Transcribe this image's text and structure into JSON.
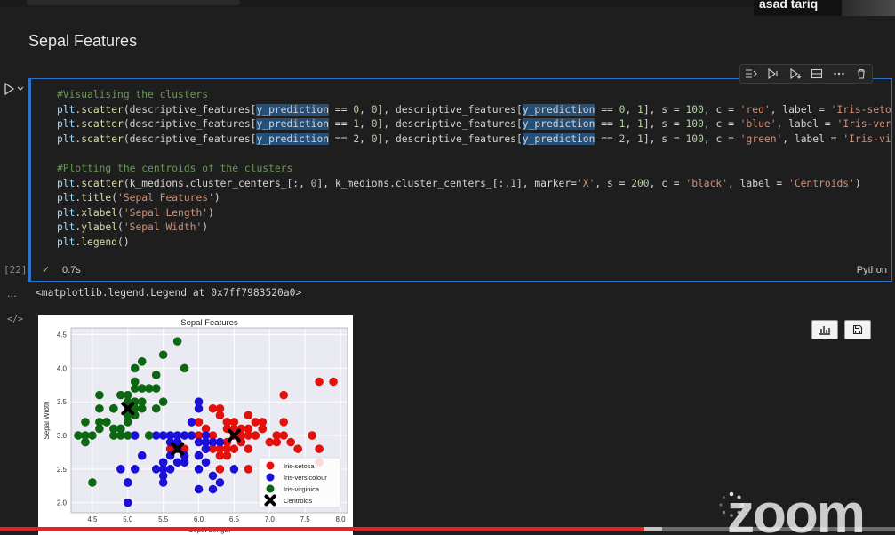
{
  "meeting": {
    "participant_name": "asad tariq",
    "app_logo": "zoom"
  },
  "notebook": {
    "markdown_heading": "Sepal Features",
    "cell": {
      "execution_count": "[22]",
      "exec_time": "0.7s",
      "language": "Python",
      "toolbar_icons": [
        "run-by-line-icon",
        "execute-above-icon",
        "execute-below-icon",
        "split-cell-icon",
        "more-icon",
        "delete-icon"
      ],
      "code_lines": [
        [
          {
            "t": "#Visualising the clusters",
            "c": "comment"
          }
        ],
        [
          {
            "t": "plt",
            "c": "var"
          },
          {
            "t": ".",
            "c": "plain"
          },
          {
            "t": "scatter",
            "c": "fn"
          },
          {
            "t": "(descriptive_features[",
            "c": "plain"
          },
          {
            "t": "y_prediction",
            "c": "hl"
          },
          {
            "t": " == ",
            "c": "plain"
          },
          {
            "t": "0",
            "c": "num"
          },
          {
            "t": ", ",
            "c": "plain"
          },
          {
            "t": "0",
            "c": "num"
          },
          {
            "t": "], descriptive_features[",
            "c": "plain"
          },
          {
            "t": "y_prediction",
            "c": "hl"
          },
          {
            "t": " == ",
            "c": "plain"
          },
          {
            "t": "0",
            "c": "num"
          },
          {
            "t": ", ",
            "c": "plain"
          },
          {
            "t": "1",
            "c": "num"
          },
          {
            "t": "], s = ",
            "c": "plain"
          },
          {
            "t": "100",
            "c": "num"
          },
          {
            "t": ", c = ",
            "c": "plain"
          },
          {
            "t": "'red'",
            "c": "str"
          },
          {
            "t": ", label = ",
            "c": "plain"
          },
          {
            "t": "'Iris-setosa'",
            "c": "str"
          }
        ],
        [
          {
            "t": "plt",
            "c": "var"
          },
          {
            "t": ".",
            "c": "plain"
          },
          {
            "t": "scatter",
            "c": "fn"
          },
          {
            "t": "(descriptive_features[",
            "c": "plain"
          },
          {
            "t": "y_prediction",
            "c": "hl"
          },
          {
            "t": " == ",
            "c": "plain"
          },
          {
            "t": "1",
            "c": "num"
          },
          {
            "t": ", ",
            "c": "plain"
          },
          {
            "t": "0",
            "c": "num"
          },
          {
            "t": "], descriptive_features[",
            "c": "plain"
          },
          {
            "t": "y_prediction",
            "c": "hl"
          },
          {
            "t": " == ",
            "c": "plain"
          },
          {
            "t": "1",
            "c": "num"
          },
          {
            "t": ", ",
            "c": "plain"
          },
          {
            "t": "1",
            "c": "num"
          },
          {
            "t": "], s = ",
            "c": "plain"
          },
          {
            "t": "100",
            "c": "num"
          },
          {
            "t": ", c = ",
            "c": "plain"
          },
          {
            "t": "'blue'",
            "c": "str"
          },
          {
            "t": ", label = ",
            "c": "plain"
          },
          {
            "t": "'Iris-versic",
            "c": "str"
          }
        ],
        [
          {
            "t": "plt",
            "c": "var"
          },
          {
            "t": ".",
            "c": "plain"
          },
          {
            "t": "scatter",
            "c": "fn"
          },
          {
            "t": "(descriptive_features[",
            "c": "plain"
          },
          {
            "t": "y_prediction",
            "c": "hl"
          },
          {
            "t": " == ",
            "c": "plain"
          },
          {
            "t": "2",
            "c": "num"
          },
          {
            "t": ", ",
            "c": "plain"
          },
          {
            "t": "0",
            "c": "num"
          },
          {
            "t": "], descriptive_features[",
            "c": "plain"
          },
          {
            "t": "y_prediction",
            "c": "hl"
          },
          {
            "t": " == ",
            "c": "plain"
          },
          {
            "t": "2",
            "c": "num"
          },
          {
            "t": ", ",
            "c": "plain"
          },
          {
            "t": "1",
            "c": "num"
          },
          {
            "t": "], s = ",
            "c": "plain"
          },
          {
            "t": "100",
            "c": "num"
          },
          {
            "t": ", c = ",
            "c": "plain"
          },
          {
            "t": "'green'",
            "c": "str"
          },
          {
            "t": ", label = ",
            "c": "plain"
          },
          {
            "t": "'Iris-virgi",
            "c": "str"
          }
        ],
        [],
        [
          {
            "t": "#Plotting the centroids of the clusters",
            "c": "comment"
          }
        ],
        [
          {
            "t": "plt",
            "c": "var"
          },
          {
            "t": ".",
            "c": "plain"
          },
          {
            "t": "scatter",
            "c": "fn"
          },
          {
            "t": "(k_medions.cluster_centers_[:, ",
            "c": "plain"
          },
          {
            "t": "0",
            "c": "num"
          },
          {
            "t": "], k_medions.cluster_centers_[:,",
            "c": "plain"
          },
          {
            "t": "1",
            "c": "num"
          },
          {
            "t": "], marker=",
            "c": "plain"
          },
          {
            "t": "'X'",
            "c": "str"
          },
          {
            "t": ", s = ",
            "c": "plain"
          },
          {
            "t": "200",
            "c": "num"
          },
          {
            "t": ", c = ",
            "c": "plain"
          },
          {
            "t": "'black'",
            "c": "str"
          },
          {
            "t": ", label = ",
            "c": "plain"
          },
          {
            "t": "'Centroids'",
            "c": "str"
          },
          {
            "t": ")",
            "c": "plain"
          }
        ],
        [
          {
            "t": "plt",
            "c": "var"
          },
          {
            "t": ".",
            "c": "plain"
          },
          {
            "t": "title",
            "c": "fn"
          },
          {
            "t": "(",
            "c": "plain"
          },
          {
            "t": "'Sepal Features'",
            "c": "str"
          },
          {
            "t": ")",
            "c": "plain"
          }
        ],
        [
          {
            "t": "plt",
            "c": "var"
          },
          {
            "t": ".",
            "c": "plain"
          },
          {
            "t": "xlabel",
            "c": "fn"
          },
          {
            "t": "(",
            "c": "plain"
          },
          {
            "t": "'Sepal Length'",
            "c": "str"
          },
          {
            "t": ")",
            "c": "plain"
          }
        ],
        [
          {
            "t": "plt",
            "c": "var"
          },
          {
            "t": ".",
            "c": "plain"
          },
          {
            "t": "ylabel",
            "c": "fn"
          },
          {
            "t": "(",
            "c": "plain"
          },
          {
            "t": "'Sepal Width'",
            "c": "str"
          },
          {
            "t": ")",
            "c": "plain"
          }
        ],
        [
          {
            "t": "plt",
            "c": "var"
          },
          {
            "t": ".",
            "c": "plain"
          },
          {
            "t": "legend",
            "c": "fn"
          },
          {
            "t": "()",
            "c": "plain"
          }
        ]
      ]
    },
    "output": {
      "dots": "...",
      "text": "<matplotlib.legend.Legend at 0x7ff7983520a0>",
      "code_icon": "</>"
    }
  },
  "video_progress": {
    "played": 0.72,
    "buffered": 0.74
  },
  "colors": {
    "accent": "#2c72c8",
    "red": "#e3100c",
    "blue": "#1a10d8",
    "green": "#0d6612",
    "progress": "#e52222"
  },
  "chart_data": {
    "type": "scatter",
    "title": "Sepal Features",
    "xlabel": "Sepal Length",
    "ylabel": "Sepal Width",
    "xlim": [
      4.2,
      8.1
    ],
    "ylim": [
      1.85,
      4.6
    ],
    "xticks": [
      "4.5",
      "5.0",
      "5.5",
      "6.0",
      "6.5",
      "7.0",
      "7.5",
      "8.0"
    ],
    "yticks": [
      "2.0",
      "2.5",
      "3.0",
      "3.5",
      "4.0",
      "4.5"
    ],
    "grid": true,
    "legend_position": "lower-right",
    "series": [
      {
        "name": "Iris-setosa",
        "color": "#e3100c",
        "points": [
          [
            7.7,
            3.8
          ],
          [
            7.9,
            3.8
          ],
          [
            7.2,
            3.6
          ],
          [
            6.4,
            3.2
          ],
          [
            6.7,
            3.1
          ],
          [
            6.9,
            3.1
          ],
          [
            6.5,
            3.2
          ],
          [
            6.3,
            3.3
          ],
          [
            6.7,
            3.3
          ],
          [
            7.2,
            3.2
          ],
          [
            6.9,
            3.2
          ],
          [
            6.8,
            3.2
          ],
          [
            6.6,
            3.0
          ],
          [
            6.7,
            3.0
          ],
          [
            6.8,
            3.0
          ],
          [
            7.1,
            3.0
          ],
          [
            7.6,
            3.0
          ],
          [
            6.5,
            3.0
          ],
          [
            6.4,
            3.1
          ],
          [
            6.1,
            3.0
          ],
          [
            6.2,
            3.0
          ],
          [
            6.3,
            2.9
          ],
          [
            6.4,
            2.9
          ],
          [
            6.5,
            2.8
          ],
          [
            6.6,
            2.9
          ],
          [
            6.7,
            2.5
          ],
          [
            6.3,
            2.7
          ],
          [
            6.4,
            2.7
          ],
          [
            6.3,
            2.5
          ],
          [
            6.2,
            2.8
          ],
          [
            6.0,
            2.7
          ],
          [
            6.3,
            2.8
          ],
          [
            6.1,
            2.8
          ],
          [
            5.9,
            3.2
          ],
          [
            6.4,
            2.8
          ],
          [
            7.2,
            3.0
          ],
          [
            7.3,
            2.9
          ],
          [
            7.4,
            2.8
          ],
          [
            7.7,
            2.8
          ],
          [
            7.7,
            2.6
          ],
          [
            6.9,
            3.1
          ],
          [
            6.0,
            3.0
          ],
          [
            6.7,
            2.8
          ],
          [
            5.8,
            2.8
          ],
          [
            6.2,
            3.4
          ],
          [
            6.0,
            3.2
          ],
          [
            7.0,
            2.9
          ],
          [
            7.1,
            2.9
          ],
          [
            5.6,
            2.8
          ],
          [
            5.8,
            2.7
          ],
          [
            6.1,
            3.1
          ],
          [
            6.3,
            3.4
          ],
          [
            6.4,
            3.2
          ],
          [
            6.5,
            3.1
          ],
          [
            6.6,
            3.1
          ]
        ]
      },
      {
        "name": "Iris-versicolour",
        "color": "#1a10d8",
        "points": [
          [
            5.0,
            2.0
          ],
          [
            4.9,
            2.5
          ],
          [
            5.0,
            2.3
          ],
          [
            5.1,
            2.5
          ],
          [
            5.0,
            2.3
          ],
          [
            5.5,
            2.3
          ],
          [
            5.5,
            2.4
          ],
          [
            5.5,
            2.5
          ],
          [
            5.5,
            2.6
          ],
          [
            5.6,
            2.5
          ],
          [
            5.6,
            2.9
          ],
          [
            5.7,
            2.8
          ],
          [
            5.7,
            2.6
          ],
          [
            5.7,
            2.9
          ],
          [
            5.8,
            2.7
          ],
          [
            5.8,
            2.6
          ],
          [
            5.9,
            3.0
          ],
          [
            6.0,
            2.2
          ],
          [
            6.2,
            2.2
          ],
          [
            6.0,
            2.9
          ],
          [
            6.0,
            3.4
          ],
          [
            6.1,
            2.9
          ],
          [
            6.0,
            2.7
          ],
          [
            6.2,
            2.9
          ],
          [
            5.9,
            3.2
          ],
          [
            5.4,
            3.0
          ],
          [
            5.6,
            3.0
          ],
          [
            5.7,
            3.0
          ],
          [
            5.5,
            3.0
          ],
          [
            5.2,
            2.7
          ],
          [
            5.6,
            2.7
          ],
          [
            5.1,
            3.0
          ],
          [
            5.7,
            2.9
          ],
          [
            6.1,
            3.0
          ],
          [
            6.2,
            2.4
          ],
          [
            6.5,
            2.5
          ],
          [
            6.3,
            2.3
          ],
          [
            6.1,
            2.6
          ],
          [
            5.8,
            3.0
          ],
          [
            6.0,
            3.5
          ],
          [
            5.4,
            2.5
          ],
          [
            5.5,
            2.6
          ],
          [
            6.1,
            2.8
          ],
          [
            6.3,
            2.9
          ],
          [
            6.0,
            2.5
          ]
        ]
      },
      {
        "name": "Iris-virginica",
        "color": "#0d6612",
        "points": [
          [
            5.7,
            4.4
          ],
          [
            5.2,
            4.1
          ],
          [
            5.5,
            4.2
          ],
          [
            5.8,
            4.0
          ],
          [
            5.4,
            3.9
          ],
          [
            5.4,
            3.7
          ],
          [
            5.1,
            3.8
          ],
          [
            5.5,
            3.5
          ],
          [
            5.2,
            3.5
          ],
          [
            5.0,
            3.6
          ],
          [
            4.9,
            3.6
          ],
          [
            5.1,
            3.5
          ],
          [
            5.0,
            3.4
          ],
          [
            4.8,
            3.4
          ],
          [
            4.6,
            3.2
          ],
          [
            4.7,
            3.2
          ],
          [
            4.6,
            3.1
          ],
          [
            4.9,
            3.1
          ],
          [
            4.8,
            3.0
          ],
          [
            4.3,
            3.0
          ],
          [
            4.4,
            2.9
          ],
          [
            4.4,
            3.0
          ],
          [
            4.5,
            2.3
          ],
          [
            5.0,
            3.5
          ],
          [
            5.1,
            3.4
          ],
          [
            5.2,
            3.4
          ],
          [
            5.0,
            3.2
          ],
          [
            5.0,
            3.0
          ],
          [
            5.3,
            3.7
          ],
          [
            5.4,
            3.4
          ],
          [
            5.1,
            3.7
          ],
          [
            5.1,
            3.3
          ],
          [
            5.3,
            3.0
          ],
          [
            4.6,
            3.4
          ],
          [
            4.8,
            3.1
          ],
          [
            4.9,
            3.0
          ],
          [
            4.4,
            3.2
          ],
          [
            4.6,
            3.6
          ],
          [
            4.8,
            3.4
          ],
          [
            5.0,
            3.3
          ],
          [
            4.9,
            3.1
          ],
          [
            4.5,
            3.0
          ],
          [
            5.2,
            3.7
          ],
          [
            4.7,
            3.2
          ],
          [
            5.1,
            3.8
          ],
          [
            5.1,
            4.0
          ]
        ]
      },
      {
        "name": "Centroids",
        "color": "#000000",
        "marker": "X",
        "points": [
          [
            5.0,
            3.4
          ],
          [
            5.7,
            2.8
          ],
          [
            6.5,
            3.0
          ]
        ]
      }
    ]
  }
}
